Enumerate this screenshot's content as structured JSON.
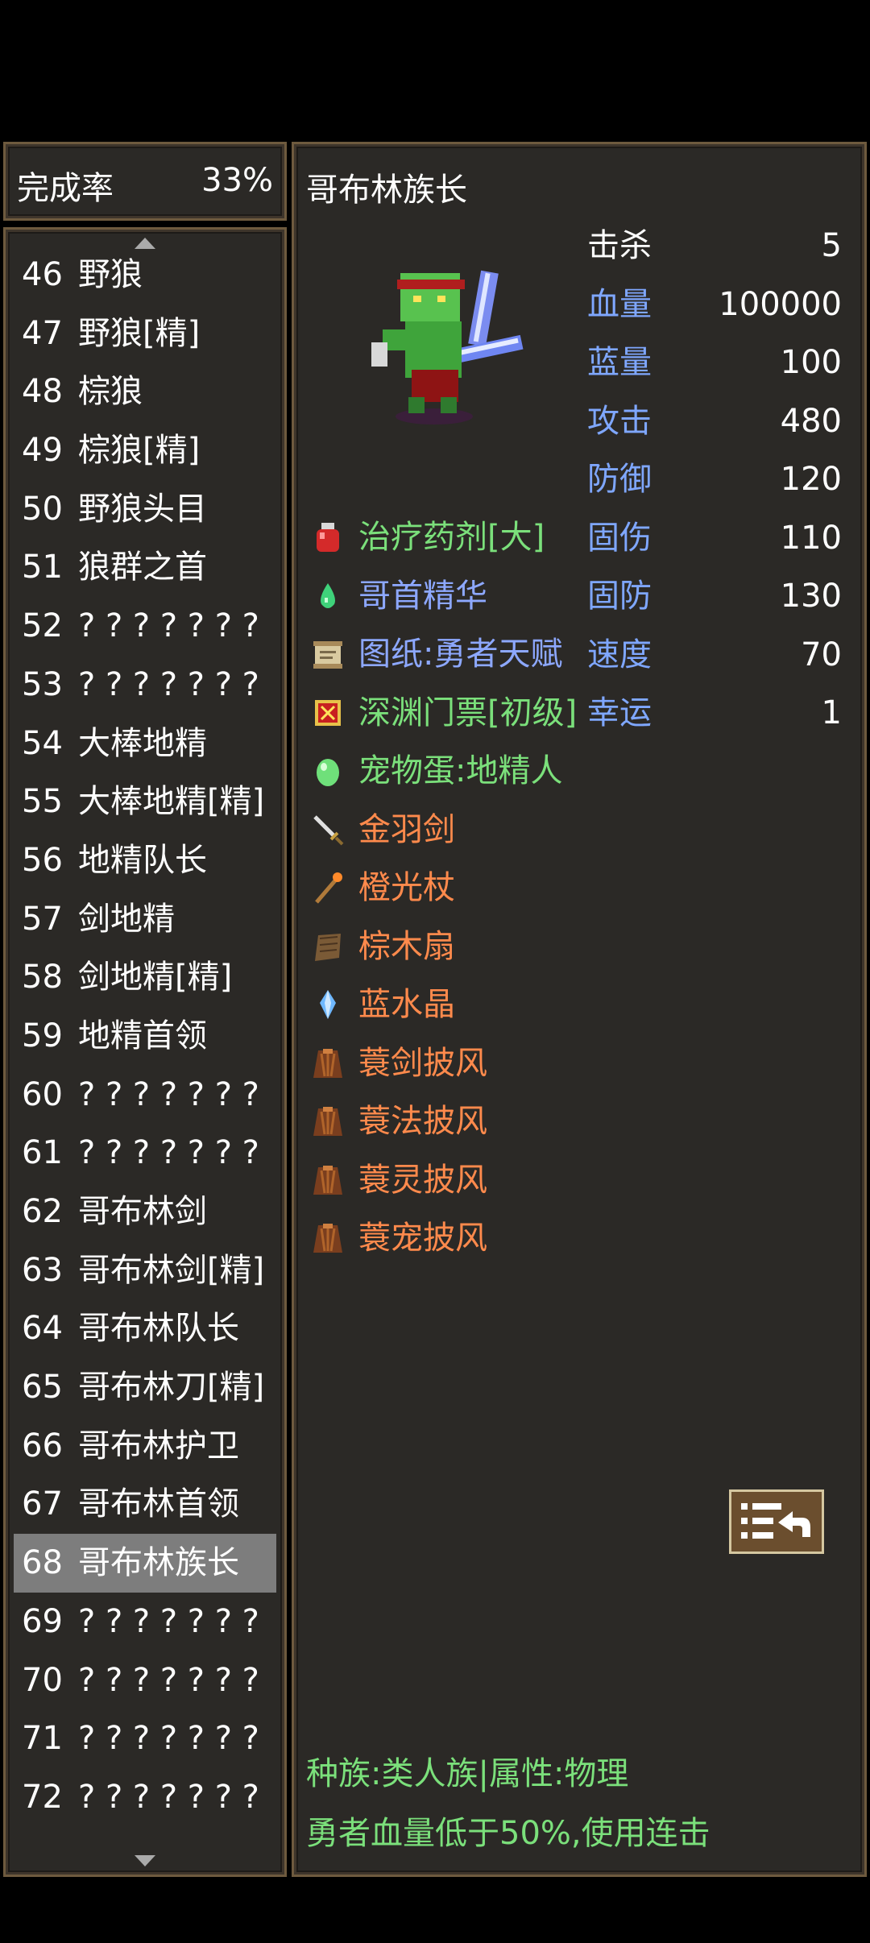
{
  "completion": {
    "label": "完成率",
    "value": "33%"
  },
  "monster_list": [
    {
      "num": "46",
      "name": "野狼"
    },
    {
      "num": "47",
      "name": "野狼[精]"
    },
    {
      "num": "48",
      "name": "棕狼"
    },
    {
      "num": "49",
      "name": "棕狼[精]"
    },
    {
      "num": "50",
      "name": "野狼头目"
    },
    {
      "num": "51",
      "name": "狼群之首"
    },
    {
      "num": "52",
      "name": "? ? ? ? ? ? ?"
    },
    {
      "num": "53",
      "name": "? ? ? ? ? ? ?"
    },
    {
      "num": "54",
      "name": "大棒地精"
    },
    {
      "num": "55",
      "name": "大棒地精[精]"
    },
    {
      "num": "56",
      "name": "地精队长"
    },
    {
      "num": "57",
      "name": "剑地精"
    },
    {
      "num": "58",
      "name": "剑地精[精]"
    },
    {
      "num": "59",
      "name": "地精首领"
    },
    {
      "num": "60",
      "name": "? ? ? ? ? ? ?"
    },
    {
      "num": "61",
      "name": "? ? ? ? ? ? ?"
    },
    {
      "num": "62",
      "name": "哥布林剑"
    },
    {
      "num": "63",
      "name": "哥布林剑[精]"
    },
    {
      "num": "64",
      "name": "哥布林队长"
    },
    {
      "num": "65",
      "name": "哥布林刀[精]"
    },
    {
      "num": "66",
      "name": "哥布林护卫"
    },
    {
      "num": "67",
      "name": "哥布林首领"
    },
    {
      "num": "68",
      "name": "哥布林族长",
      "selected": true
    },
    {
      "num": "69",
      "name": "? ? ? ? ? ? ?"
    },
    {
      "num": "70",
      "name": "? ? ? ? ? ? ?"
    },
    {
      "num": "71",
      "name": "? ? ? ? ? ? ?"
    },
    {
      "num": "72",
      "name": "? ? ? ? ? ? ?"
    }
  ],
  "detail": {
    "name": "哥布林族长",
    "stats": [
      {
        "label": "击杀",
        "value": "5",
        "color": "white"
      },
      {
        "label": "血量",
        "value": "100000",
        "color": "blue"
      },
      {
        "label": "蓝量",
        "value": "100",
        "color": "blue"
      },
      {
        "label": "攻击",
        "value": "480",
        "color": "blue"
      },
      {
        "label": "防御",
        "value": "120",
        "color": "blue"
      },
      {
        "label": "固伤",
        "value": "110",
        "color": "blue"
      },
      {
        "label": "固防",
        "value": "130",
        "color": "blue"
      },
      {
        "label": "速度",
        "value": "70",
        "color": "blue"
      },
      {
        "label": "幸运",
        "value": "1",
        "color": "blue"
      }
    ],
    "drops": [
      {
        "name": "治疗药剂[大]",
        "color": "green",
        "icon": "red-potion-icon"
      },
      {
        "name": "哥首精华",
        "color": "blue",
        "icon": "green-drop-icon"
      },
      {
        "name": "图纸:勇者天赋",
        "color": "blue",
        "icon": "scroll-icon"
      },
      {
        "name": "深渊门票[初级]",
        "color": "green",
        "icon": "ticket-icon"
      },
      {
        "name": "宠物蛋:地精人",
        "color": "green",
        "icon": "egg-icon"
      },
      {
        "name": "金羽剑",
        "color": "orange",
        "icon": "sword-icon"
      },
      {
        "name": "橙光杖",
        "color": "orange",
        "icon": "staff-icon"
      },
      {
        "name": "棕木扇",
        "color": "orange",
        "icon": "fan-icon"
      },
      {
        "name": "蓝水晶",
        "color": "orange",
        "icon": "crystal-icon"
      },
      {
        "name": "蓑剑披风",
        "color": "orange",
        "icon": "cloak-icon"
      },
      {
        "name": "蓑法披风",
        "color": "orange",
        "icon": "cloak-icon"
      },
      {
        "name": "蓑灵披风",
        "color": "orange",
        "icon": "cloak-icon"
      },
      {
        "name": "蓑宠披风",
        "color": "orange",
        "icon": "cloak-icon"
      }
    ],
    "race_line": "种族:类人族|属性:物理",
    "behavior_line": "勇者血量低于50%,使用连击"
  }
}
